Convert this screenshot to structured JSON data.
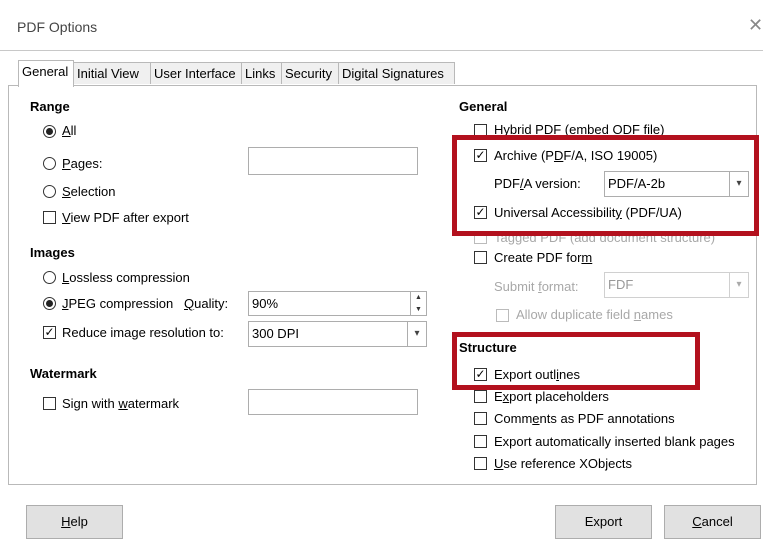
{
  "window": {
    "title": "PDF Options",
    "close": "✕"
  },
  "tabs": [
    "General",
    "Initial View",
    "User Interface",
    "Links",
    "Security",
    "Digital Signatures"
  ],
  "range": {
    "heading": "Range",
    "all": "All",
    "pages": "Pages:",
    "pages_value": "",
    "selection": "Selection",
    "view_after_export": "View PDF after export"
  },
  "images": {
    "heading": "Images",
    "lossless": "Lossless compression",
    "jpeg": "JPEG compression",
    "quality_label": "Quality:",
    "quality_value": "90%",
    "reduce": "Reduce image resolution to:",
    "resolution": "300 DPI"
  },
  "watermark": {
    "heading": "Watermark",
    "sign": "Sign with watermark",
    "value": ""
  },
  "general": {
    "heading": "General",
    "hybrid": "Hybrid PDF (embed ODF file)",
    "archive": "Archive (PDF/A, ISO 19005)",
    "pdfa_version_label": "PDF/A version:",
    "pdfa_version": "PDF/A-2b",
    "accessibility": "Universal Accessibility (PDF/UA)",
    "tagged": "Tagged PDF (add document structure)",
    "create_form": "Create PDF form",
    "submit_label": "Submit format:",
    "submit_value": "FDF",
    "duplicate": "Allow duplicate field names"
  },
  "structure": {
    "heading": "Structure",
    "outlines": "Export outlines",
    "placeholders": "Export placeholders",
    "comments": "Comments as PDF annotations",
    "blank_pages": "Export automatically inserted blank pages",
    "xobjects": "Use reference XObjects"
  },
  "buttons": {
    "help": "Help",
    "export": "Export",
    "cancel": "Cancel"
  },
  "colors": {
    "highlight": "#b3111e"
  }
}
